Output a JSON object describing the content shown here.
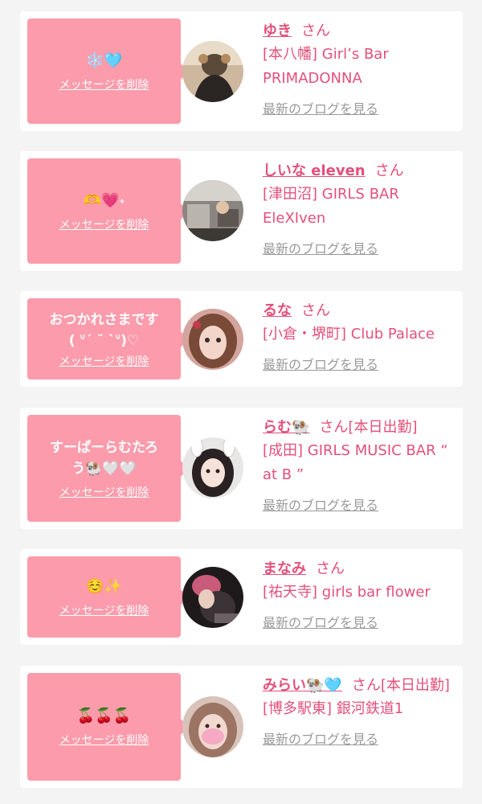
{
  "colors": {
    "accent": "#fc9bab",
    "name_pink": "#e3507a",
    "link_gray": "#9a9a9a"
  },
  "delete_label": "メッセージを削除",
  "blog_label": "最新のブログを見る",
  "cards": [
    {
      "message": "❄️🩵",
      "name": "ゆき",
      "honorific": "さん",
      "status": "",
      "shop": "[本八幡] Girl’s Bar PRIMADONNA"
    },
    {
      "message": "🫶💗˖",
      "name": "しいな eleven",
      "honorific": "さん",
      "status": "",
      "shop": "[津田沼] GIRLS BAR EleXIven"
    },
    {
      "message": "おつかれさまです\n( ᐡ´ ˘ `ᐡ)♡",
      "name": "るな",
      "honorific": "さん",
      "status": "",
      "shop": "[小倉・堺町] Club Palace"
    },
    {
      "message": "すーぱーらむたろ\nう🐏🤍🤍",
      "name": "らむ🐏",
      "honorific": "さん",
      "status": "[本日出勤]",
      "shop": "[成田] GIRLS MUSIC BAR “ at B ”"
    },
    {
      "message": "☺️✨",
      "name": "まなみ",
      "honorific": "さん",
      "status": "",
      "shop": "[祐天寺] girls bar flower"
    },
    {
      "message": "🍒🍒🍒",
      "name": "みらい🐏🩵",
      "honorific": "さん",
      "status": "[本日出勤]",
      "shop": "[博多駅東] 銀河鉄道1"
    }
  ]
}
